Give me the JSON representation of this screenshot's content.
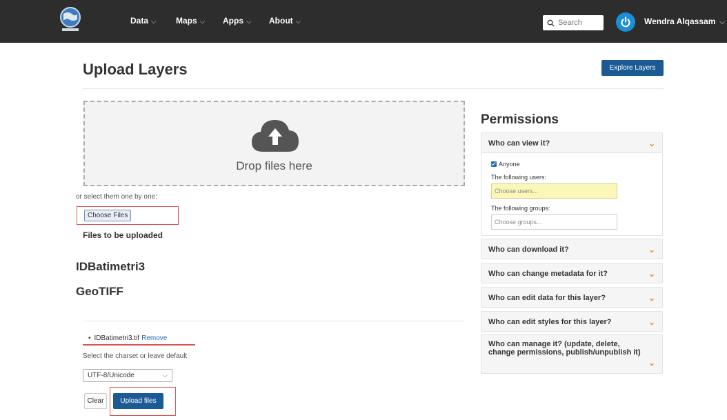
{
  "nav": {
    "items": [
      {
        "label": "Data"
      },
      {
        "label": "Maps"
      },
      {
        "label": "Apps"
      },
      {
        "label": "About"
      }
    ],
    "search_placeholder": "Search",
    "username": "Wendra Alqassam"
  },
  "page": {
    "title": "Upload Layers",
    "explore_button": "Explore Layers"
  },
  "upload": {
    "drop_text": "Drop files here",
    "select_label": "or select them one by one:",
    "choose_button": "Choose Files",
    "files_heading": "Files to be uploaded",
    "layer_name": "IDBatimetri3",
    "layer_type": "GeoTIFF",
    "file_name": "IDBatimetri3.tif",
    "remove_label": "Remove",
    "charset_label": "Select the charset or leave default",
    "charset_value": "UTF-8/Unicode",
    "clear_button": "Clear",
    "upload_button": "Upload files"
  },
  "permissions": {
    "title": "Permissions",
    "view": {
      "header": "Who can view it?",
      "anyone_label": "Anyone",
      "anyone_checked": true,
      "users_label": "The following users:",
      "users_placeholder": "Choose users...",
      "groups_label": "The following groups:",
      "groups_placeholder": "Choose groups..."
    },
    "panels": [
      {
        "header": "Who can download it?"
      },
      {
        "header": "Who can change metadata for it?"
      },
      {
        "header": "Who can edit data for this layer?"
      },
      {
        "header": "Who can edit styles for this layer?"
      },
      {
        "header": "Who can manage it? (update, delete, change permissions, publish/unpublish it)"
      }
    ]
  },
  "colors": {
    "navbar": "#2d2d2d",
    "primary_button": "#1c5a96",
    "accent_chevron": "#e8902a",
    "highlight_box": "#d9534f",
    "avatar": "#1a8fd6"
  }
}
